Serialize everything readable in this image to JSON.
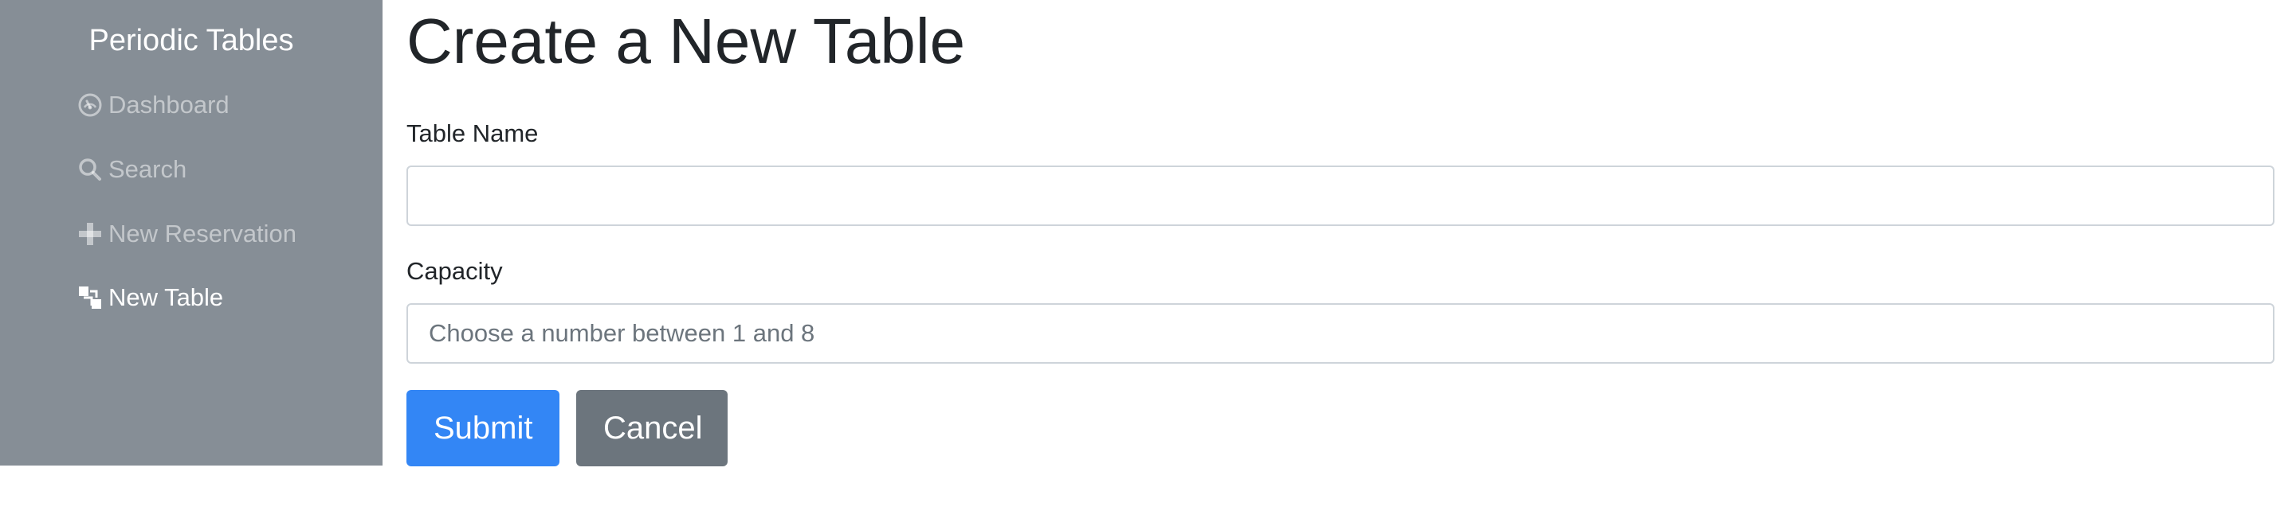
{
  "sidebar": {
    "brand": "Periodic Tables",
    "items": [
      {
        "label": "Dashboard",
        "icon": "dashboard-icon",
        "active": false
      },
      {
        "label": "Search",
        "icon": "search-icon",
        "active": false
      },
      {
        "label": "New Reservation",
        "icon": "plus-icon",
        "active": false
      },
      {
        "label": "New Table",
        "icon": "layers-icon",
        "active": true
      }
    ]
  },
  "main": {
    "title": "Create a New Table",
    "form": {
      "table_name": {
        "label": "Table Name",
        "value": "",
        "placeholder": ""
      },
      "capacity": {
        "label": "Capacity",
        "value": "",
        "placeholder": "Choose a number between 1 and 8"
      },
      "submit_label": "Submit",
      "cancel_label": "Cancel"
    }
  },
  "colors": {
    "sidebar_bg": "#868e96",
    "primary": "#3386f5",
    "secondary": "#6c757d",
    "text": "#212529"
  }
}
